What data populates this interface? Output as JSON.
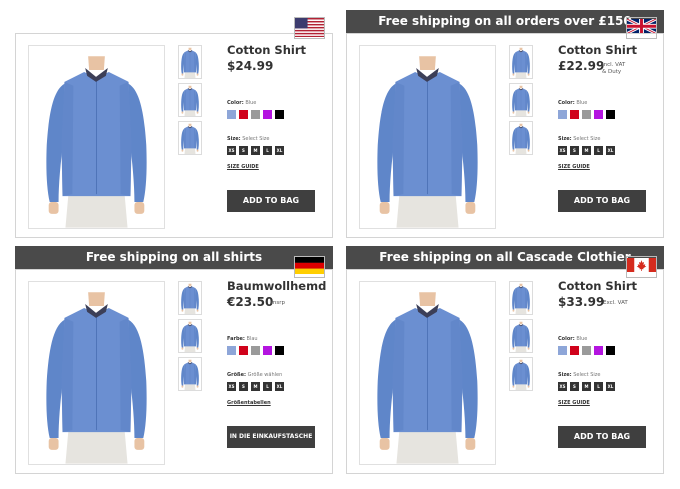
{
  "colors": {
    "swatches": [
      "#8ea6d8",
      "#d0021b",
      "#9a9a9a",
      "#b414e0",
      "#000000"
    ],
    "banner_bg": "#4a4a4a",
    "button_bg": "#3f3f3f"
  },
  "cards": [
    {
      "region": "us",
      "flag": "us-flag",
      "banner": "",
      "title": "Cotton Shirt",
      "price": "$24.99",
      "price_note": "",
      "price_note_2": "",
      "color_label": "Color:",
      "color_value": "Blue",
      "size_label": "Size:",
      "size_value": "Select Size",
      "sizes": [
        "XS",
        "S",
        "M",
        "L",
        "XL"
      ],
      "size_guide": "SIZE GUIDE",
      "button": "ADD TO BAG"
    },
    {
      "region": "uk",
      "flag": "uk-flag",
      "banner": "Free shipping on all orders over £150",
      "title": "Cotton Shirt",
      "price": "£22.99",
      "price_note": "Incl. VAT",
      "price_note_2": "& Duty",
      "color_label": "Color:",
      "color_value": "Blue",
      "size_label": "Size:",
      "size_value": "Select Size",
      "sizes": [
        "XS",
        "S",
        "M",
        "L",
        "XL"
      ],
      "size_guide": "SIZE GUIDE",
      "button": "ADD TO BAG"
    },
    {
      "region": "de",
      "flag": "germany-flag",
      "banner": "Free shipping on all shirts",
      "title": "Baumwollhemd",
      "price": "€23.50",
      "price_note": "msrp",
      "price_note_2": "",
      "color_label": "Farbe:",
      "color_value": "Blau",
      "size_label": "Größe:",
      "size_value": "Größe wählen",
      "sizes": [
        "XS",
        "S",
        "M",
        "L",
        "XL"
      ],
      "size_guide": "Größentabellen",
      "button": "IN DIE EINKAUFSTASCHE"
    },
    {
      "region": "ca",
      "flag": "canada-flag",
      "banner": "Free shipping on all Cascade Clothier",
      "title": "Cotton Shirt",
      "price": "$33.99",
      "price_note": "Excl. VAT",
      "price_note_2": "",
      "color_label": "Color:",
      "color_value": "Blue",
      "size_label": "Size:",
      "size_value": "Select Size",
      "sizes": [
        "XS",
        "S",
        "M",
        "L",
        "XL"
      ],
      "size_guide": "SIZE GUIDE",
      "button": "ADD TO BAG"
    }
  ]
}
